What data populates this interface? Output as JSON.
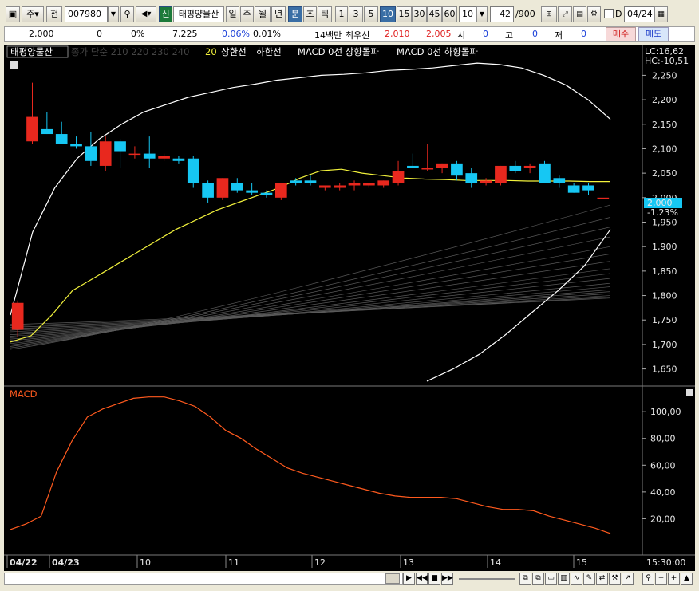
{
  "toolbar": {
    "market_mode": "주",
    "prev_label": "전",
    "stock_code": "007980",
    "credit_badge": "신",
    "stock_name": "태평양물산",
    "period_tabs": [
      "일",
      "주",
      "월",
      "년",
      "분",
      "초",
      "틱"
    ],
    "active_period": "분",
    "intervals": [
      "1",
      "3",
      "5",
      "10",
      "15",
      "30",
      "45",
      "60"
    ],
    "active_interval": "10",
    "interval_select": "10",
    "count": "42",
    "count_total": "/900",
    "d_label": "D",
    "date": "04/24"
  },
  "info_bar": {
    "price": "2,000",
    "change": "0",
    "change_pct": "0%",
    "volume": "7,225",
    "rate1": "0.06%",
    "rate2": "0.01%",
    "amount": "14백만",
    "best_label": "최우선",
    "ask": "2,010",
    "bid": "2,005",
    "open_label": "시",
    "open_value": "0",
    "high_label": "고",
    "high_value": "0",
    "low_label": "저",
    "low_value": "0",
    "buy_button": "매수",
    "sell_button": "매도"
  },
  "legend": {
    "stock": "태평양물산",
    "ma_text": "종가 단순 210 220 230 240",
    "ma_period": "20",
    "band_upper": "상한선",
    "band_lower": "하한선",
    "macd_up": "MACD 0선 상향돌파",
    "macd_down": "MACD 0선 하향돌파",
    "lc": "LC:16,62",
    "hc": "HC:-10,51",
    "macd_title": "MACD"
  },
  "price_axis": {
    "labels": [
      "2,250",
      "2,200",
      "2,150",
      "2,100",
      "2,050",
      "2,000",
      "1,950",
      "1,900",
      "1,850",
      "1,800",
      "1,750",
      "1,700",
      "1,650"
    ],
    "current_price": "2,000",
    "current_change": "-1.23%"
  },
  "macd_axis": {
    "labels": [
      "100,00",
      "80,00",
      "60,00",
      "40,00",
      "20,00"
    ]
  },
  "time_axis": {
    "labels": [
      "04/22",
      "04/23",
      "10",
      "11",
      "12",
      "13",
      "14",
      "15"
    ],
    "clock": "15:30:00"
  },
  "colors": {
    "up": "#e8281e",
    "down": "#16c7f3",
    "ma": "#f2f23c",
    "band": "#ffffff",
    "macd": "#ff5a1e",
    "ma_long": "#5a5a5a"
  },
  "chart_data": [
    {
      "type": "candlestick",
      "ylim": [
        1620,
        2280
      ],
      "candles": [
        {
          "o": 1730,
          "h": 1790,
          "l": 1715,
          "c": 1785
        },
        {
          "o": 2115,
          "h": 2235,
          "l": 2110,
          "c": 2165
        },
        {
          "o": 2140,
          "h": 2175,
          "l": 2130,
          "c": 2130
        },
        {
          "o": 2130,
          "h": 2155,
          "l": 2110,
          "c": 2110
        },
        {
          "o": 2110,
          "h": 2125,
          "l": 2100,
          "c": 2105
        },
        {
          "o": 2105,
          "h": 2135,
          "l": 2065,
          "c": 2075
        },
        {
          "o": 2065,
          "h": 2125,
          "l": 2055,
          "c": 2115
        },
        {
          "o": 2115,
          "h": 2120,
          "l": 2060,
          "c": 2095
        },
        {
          "o": 2090,
          "h": 2105,
          "l": 2080,
          "c": 2090
        },
        {
          "o": 2090,
          "h": 2125,
          "l": 2060,
          "c": 2080
        },
        {
          "o": 2080,
          "h": 2090,
          "l": 2075,
          "c": 2085
        },
        {
          "o": 2080,
          "h": 2085,
          "l": 2070,
          "c": 2075
        },
        {
          "o": 2080,
          "h": 2085,
          "l": 2020,
          "c": 2030
        },
        {
          "o": 2030,
          "h": 2035,
          "l": 1990,
          "c": 2000
        },
        {
          "o": 2000,
          "h": 2040,
          "l": 1995,
          "c": 2040
        },
        {
          "o": 2030,
          "h": 2040,
          "l": 2010,
          "c": 2015
        },
        {
          "o": 2015,
          "h": 2030,
          "l": 2005,
          "c": 2010
        },
        {
          "o": 2010,
          "h": 2015,
          "l": 2000,
          "c": 2005
        },
        {
          "o": 2000,
          "h": 2030,
          "l": 1995,
          "c": 2030
        },
        {
          "o": 2035,
          "h": 2040,
          "l": 2025,
          "c": 2030
        },
        {
          "o": 2035,
          "h": 2045,
          "l": 2025,
          "c": 2030
        },
        {
          "o": 2020,
          "h": 2025,
          "l": 2015,
          "c": 2025
        },
        {
          "o": 2020,
          "h": 2030,
          "l": 2015,
          "c": 2025
        },
        {
          "o": 2025,
          "h": 2035,
          "l": 2015,
          "c": 2030
        },
        {
          "o": 2025,
          "h": 2030,
          "l": 2020,
          "c": 2030
        },
        {
          "o": 2025,
          "h": 2035,
          "l": 2020,
          "c": 2035
        },
        {
          "o": 2030,
          "h": 2075,
          "l": 2025,
          "c": 2055
        },
        {
          "o": 2065,
          "h": 2090,
          "l": 2060,
          "c": 2060
        },
        {
          "o": 2060,
          "h": 2110,
          "l": 2055,
          "c": 2060
        },
        {
          "o": 2060,
          "h": 2070,
          "l": 2050,
          "c": 2070
        },
        {
          "o": 2070,
          "h": 2075,
          "l": 2035,
          "c": 2045
        },
        {
          "o": 2050,
          "h": 2060,
          "l": 2020,
          "c": 2030
        },
        {
          "o": 2030,
          "h": 2040,
          "l": 2025,
          "c": 2035
        },
        {
          "o": 2030,
          "h": 2065,
          "l": 2025,
          "c": 2065
        },
        {
          "o": 2065,
          "h": 2075,
          "l": 2050,
          "c": 2055
        },
        {
          "o": 2060,
          "h": 2070,
          "l": 2050,
          "c": 2065
        },
        {
          "o": 2070,
          "h": 2075,
          "l": 2030,
          "c": 2030
        },
        {
          "o": 2040,
          "h": 2045,
          "l": 2020,
          "c": 2030
        },
        {
          "o": 2025,
          "h": 2030,
          "l": 2010,
          "c": 2010
        },
        {
          "o": 2025,
          "h": 2030,
          "l": 2005,
          "c": 2015
        },
        {
          "o": 2000,
          "h": 2000,
          "l": 2000,
          "c": 2000
        }
      ],
      "ma20": [
        1705,
        1718,
        1760,
        1810,
        1835,
        1860,
        1885,
        1910,
        1935,
        1955,
        1975,
        1990,
        2005,
        2020,
        2040,
        2055,
        2058,
        2050,
        2045,
        2040,
        2038,
        2037,
        2035,
        2035,
        2035,
        2034,
        2034,
        2034,
        2033,
        2033
      ],
      "band_upper": [
        1760,
        1930,
        2020,
        2080,
        2120,
        2150,
        2175,
        2190,
        2205,
        2215,
        2225,
        2232,
        2240,
        2245,
        2250,
        2252,
        2255,
        2260,
        2262,
        2265,
        2270,
        2275,
        2272,
        2265,
        2250,
        2230,
        2200,
        2160
      ],
      "band_lower": [
        1625,
        1650,
        1680,
        1720,
        1765,
        1810,
        1860,
        1935
      ],
      "long_ma_ends": [
        1985,
        1960,
        1940,
        1920,
        1900,
        1885,
        1870,
        1855,
        1845,
        1835,
        1825,
        1818,
        1812,
        1808,
        1804,
        1800,
        1797,
        1795
      ]
    },
    {
      "type": "line",
      "name": "MACD",
      "ylim": [
        0,
        115
      ],
      "values": [
        12,
        16,
        22,
        55,
        78,
        96,
        102,
        106,
        110,
        111,
        111,
        108,
        104,
        96,
        86,
        80,
        72,
        65,
        58,
        54,
        51,
        48,
        45,
        42,
        39,
        37,
        36,
        36,
        36,
        35,
        32,
        29,
        27,
        27,
        26,
        22,
        19,
        16,
        13,
        9
      ]
    }
  ]
}
